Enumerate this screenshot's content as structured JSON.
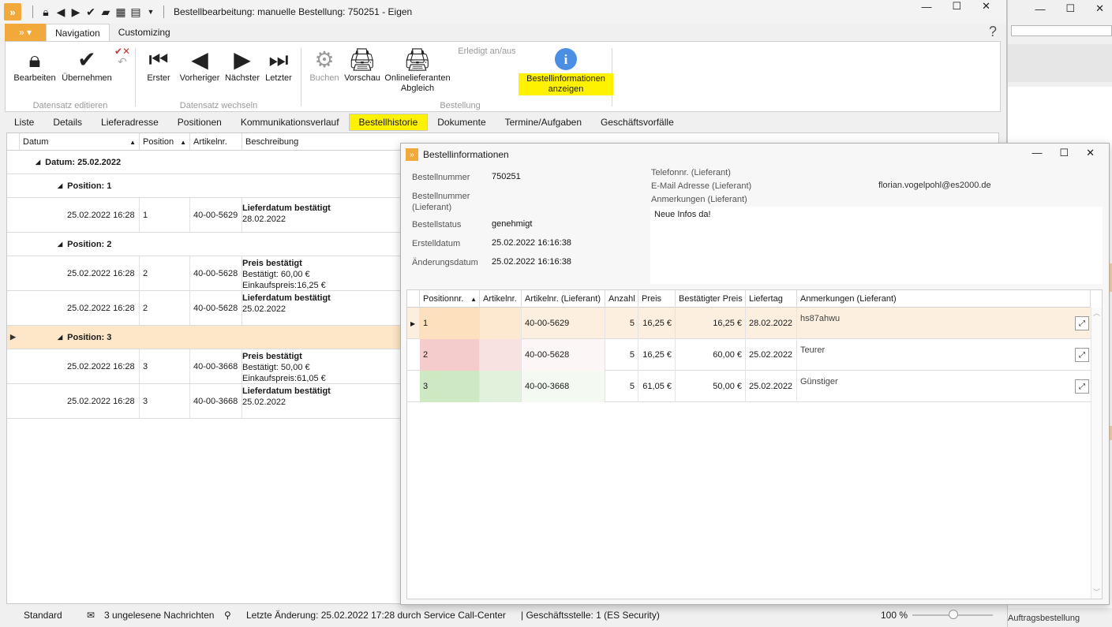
{
  "window": {
    "title": "Bestellbearbeitung: manuelle Bestellung: 750251 - Eigen"
  },
  "ribbon": {
    "tabs": [
      "Navigation",
      "Customizing"
    ],
    "buttons": {
      "bearbeiten": "Bearbeiten",
      "uebernehmen": "Übernehmen",
      "erster": "Erster",
      "vorheriger": "Vorheriger",
      "naechster": "Nächster",
      "letzter": "Letzter",
      "buchen": "Buchen",
      "vorschau": "Vorschau",
      "onlinelieferanten_1": "Onlinelieferanten",
      "onlinelieferanten_2": "Abgleich",
      "erledigt": "Erledigt an/aus",
      "bestellinfo_1": "Bestellinformationen",
      "bestellinfo_2": "anzeigen"
    },
    "groups": {
      "datensatz_editieren": "Datensatz editieren",
      "datensatz_wechseln": "Datensatz wechseln",
      "bestellung": "Bestellung"
    }
  },
  "content_tabs": [
    "Liste",
    "Details",
    "Lieferadresse",
    "Positionen",
    "Kommunikationsverlauf",
    "Bestellhistorie",
    "Dokumente",
    "Termine/Aufgaben",
    "Geschäftsvorfälle"
  ],
  "history": {
    "columns": {
      "datum": "Datum",
      "position": "Position",
      "artikel": "Artikelnr.",
      "beschreibung": "Beschreibung"
    },
    "date_group": "Datum: 25.02.2022",
    "groups": [
      {
        "label": "Position: 1",
        "rows": [
          {
            "datum": "25.02.2022 16:28",
            "pos": "1",
            "artikel": "40-00-5629",
            "title": "Lieferdatum bestätigt",
            "lines": [
              "28.02.2022"
            ]
          }
        ]
      },
      {
        "label": "Position: 2",
        "rows": [
          {
            "datum": "25.02.2022 16:28",
            "pos": "2",
            "artikel": "40-00-5628",
            "title": "Preis bestätigt",
            "lines": [
              "Bestätigt: 60,00 €",
              "Einkaufspreis:16,25 €"
            ]
          },
          {
            "datum": "25.02.2022 16:28",
            "pos": "2",
            "artikel": "40-00-5628",
            "title": "Lieferdatum bestätigt",
            "lines": [
              "25.02.2022"
            ]
          }
        ]
      },
      {
        "label": "Position: 3",
        "rows": [
          {
            "datum": "25.02.2022 16:28",
            "pos": "3",
            "artikel": "40-00-3668",
            "title": "Preis bestätigt",
            "lines": [
              "Bestätigt: 50,00 €",
              "Einkaufspreis:61,05 €"
            ]
          },
          {
            "datum": "25.02.2022 16:28",
            "pos": "3",
            "artikel": "40-00-3668",
            "title": "Lieferdatum bestätigt",
            "lines": [
              "25.02.2022"
            ]
          }
        ]
      }
    ]
  },
  "dialog": {
    "title": "Bestellinformationen",
    "labels": {
      "bestellnummer": "Bestellnummer",
      "bestellnummer_lief_1": "Bestellnummer",
      "bestellnummer_lief_2": "(Lieferant)",
      "bestellstatus": "Bestellstatus",
      "erstelldatum": "Erstelldatum",
      "aenderungsdatum": "Änderungsdatum",
      "telefon": "Telefonnr. (Lieferant)",
      "email": "E-Mail Adresse (Lieferant)",
      "anmerkungen": "Anmerkungen (Lieferant)"
    },
    "values": {
      "bestellnummer": "750251",
      "bestellstatus": "genehmigt",
      "erstelldatum": "25.02.2022 16:16:38",
      "aenderungsdatum": "25.02.2022 16:16:38",
      "email": "florian.vogelpohl@es2000.de",
      "anmerkungen": "Neue Infos da!"
    },
    "grid_columns": [
      "Positionnr.",
      "Artikelnr.",
      "Artikelnr. (Lieferant)",
      "Anzahl",
      "Preis",
      "Bestätigter Preis",
      "Liefertag",
      "Anmerkungen (Lieferant)"
    ],
    "rows": [
      {
        "pos": "1",
        "artikel": "",
        "artikel_lief": "40-00-5629",
        "anzahl": "5",
        "preis": "16,25 €",
        "bestaetigt": "16,25 €",
        "liefertag": "28.02.2022",
        "anmerkung": "hs87ahwu"
      },
      {
        "pos": "2",
        "artikel": "",
        "artikel_lief": "40-00-5628",
        "anzahl": "5",
        "preis": "16,25 €",
        "bestaetigt": "60,00 €",
        "liefertag": "25.02.2022",
        "anmerkung": "Teurer"
      },
      {
        "pos": "3",
        "artikel": "",
        "artikel_lief": "40-00-3668",
        "anzahl": "5",
        "preis": "61,05 €",
        "bestaetigt": "50,00 €",
        "liefertag": "25.02.2022",
        "anmerkung": "Günstiger"
      }
    ]
  },
  "statusbar": {
    "mode": "Standard",
    "messages": "3 ungelesene Nachrichten",
    "last_change": "Letzte Änderung: 25.02.2022 17:28 durch Service Call-Center",
    "office": "| Geschäftsstelle:  1 (ES Security)",
    "zoom": "100 %"
  },
  "background_window": {
    "status": "Auftragsbestellung"
  },
  "colors": {
    "accent": "#f2a93b",
    "highlight": "#fff200",
    "row_selected": "#fde7c8",
    "row_red": "#f4cccc",
    "row_green": "#cfe8c4"
  }
}
